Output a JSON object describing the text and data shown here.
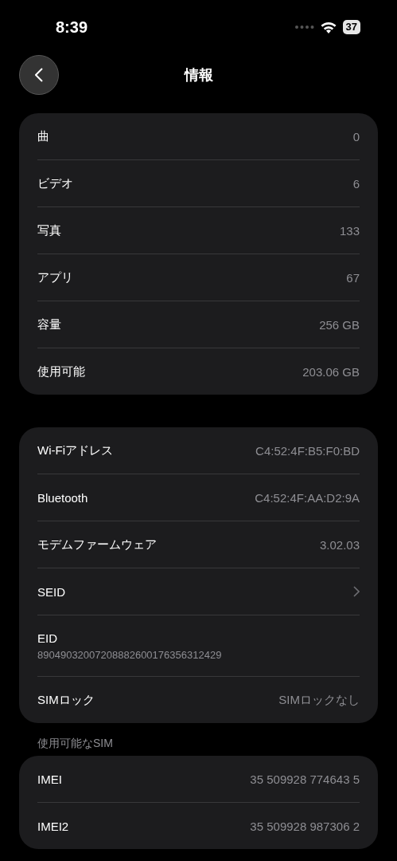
{
  "status_bar": {
    "time": "8:39",
    "battery": "37"
  },
  "nav": {
    "title": "情報"
  },
  "groups": [
    {
      "rows": [
        {
          "kind": "value",
          "label": "曲",
          "value": "0"
        },
        {
          "kind": "value",
          "label": "ビデオ",
          "value": "6"
        },
        {
          "kind": "value",
          "label": "写真",
          "value": "133"
        },
        {
          "kind": "value",
          "label": "アプリ",
          "value": "67"
        },
        {
          "kind": "value",
          "label": "容量",
          "value": "256 GB"
        },
        {
          "kind": "value",
          "label": "使用可能",
          "value": "203.06 GB"
        }
      ]
    },
    {
      "rows": [
        {
          "kind": "value",
          "label": "Wi-Fiアドレス",
          "value": "C4:52:4F:B5:F0:BD"
        },
        {
          "kind": "value",
          "label": "Bluetooth",
          "value": "C4:52:4F:AA:D2:9A"
        },
        {
          "kind": "value",
          "label": "モデムファームウェア",
          "value": "3.02.03"
        },
        {
          "kind": "link",
          "label": "SEID"
        },
        {
          "kind": "stacked",
          "label": "EID",
          "value": "89049032007208882600176356312429"
        },
        {
          "kind": "value",
          "label": "SIMロック",
          "value": "SIMロックなし"
        }
      ]
    },
    {
      "header": "使用可能なSIM",
      "rows": [
        {
          "kind": "value",
          "label": "IMEI",
          "value": "35 509928 774643 5"
        },
        {
          "kind": "value",
          "label": "IMEI2",
          "value": "35 509928 987306 2"
        }
      ]
    }
  ]
}
